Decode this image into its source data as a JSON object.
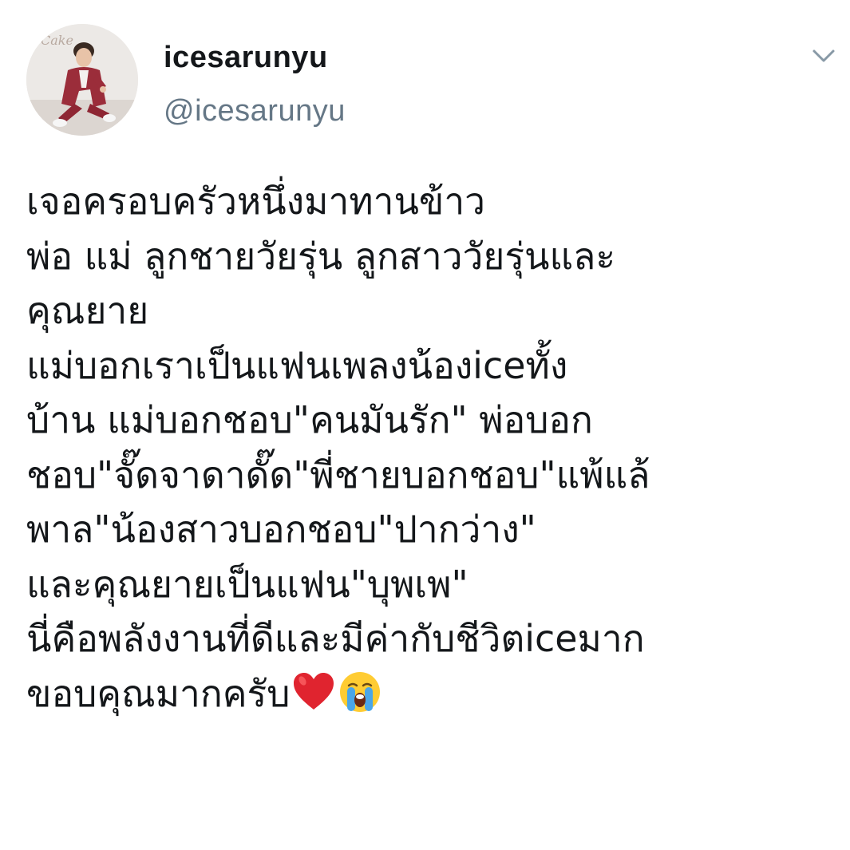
{
  "tweet": {
    "author": {
      "display_name": "icesarunyu",
      "handle": "@icesarunyu",
      "avatar_label": "Cake"
    },
    "menu_icon": "chevron-down-icon",
    "lines": [
      "เจอครอบครัวหนึ่งมาทานข้าว",
      "พ่อ แม่ ลูกชายวัยรุ่น ลูกสาววัยรุ่นและ",
      "คุณยาย",
      "แม่บอกเราเป็นแฟนเพลงน้องiceทั้ง",
      "บ้าน แม่บอกชอบ\"คนมันรัก\" พ่อบอก",
      "ชอบ\"จั๊ดจาดาดั๊ด\"พี่ชายบอกชอบ\"แพ้แล้",
      "พาล\"น้องสาวบอกชอบ\"ปากว่าง\"",
      "และคุณยายเป็นแฟน\"บุพเพ\"",
      "นี่คือพลังงานที่ดีและมีค่ากับชีวิตiceมาก",
      "ขอบคุณมากครับ"
    ],
    "trailing_emoji": [
      "red-heart-emoji",
      "loudly-crying-face-emoji"
    ],
    "colors": {
      "text": "#14171a",
      "secondary": "#657786",
      "heart": "#e0242f"
    }
  }
}
